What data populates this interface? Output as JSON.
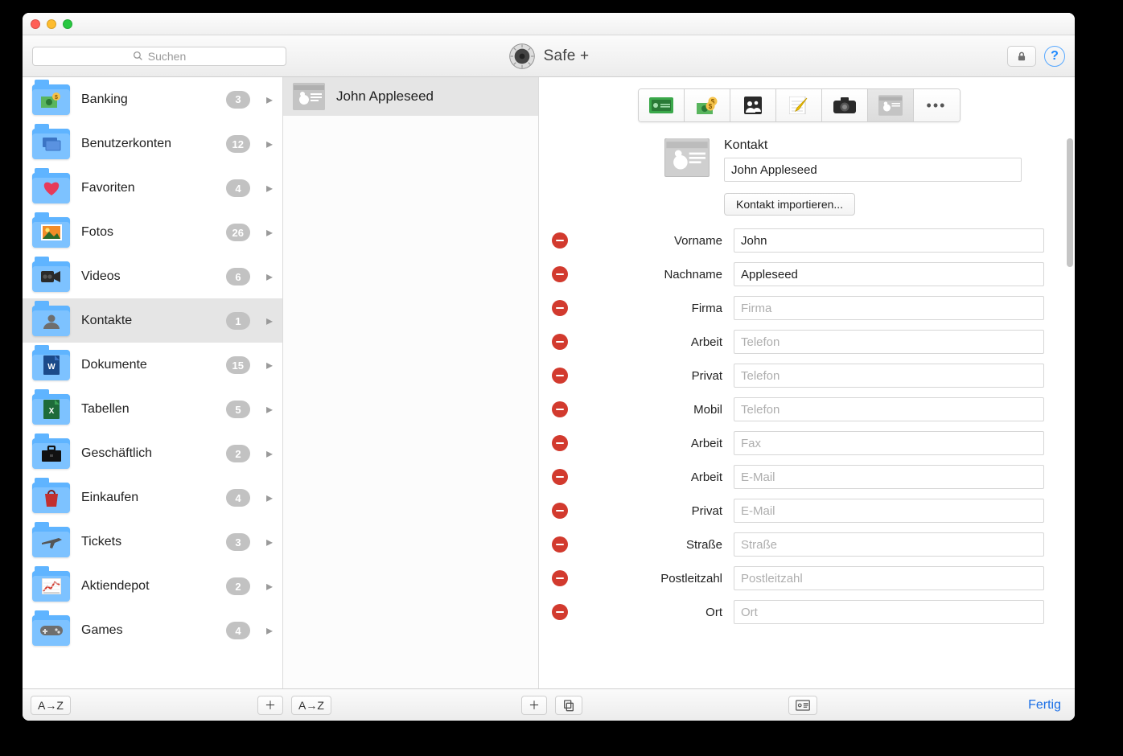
{
  "app": {
    "title": "Safe +"
  },
  "toolbar": {
    "search_placeholder": "Suchen"
  },
  "sidebar": {
    "categories": [
      {
        "id": "banking",
        "label": "Banking",
        "count": 3,
        "icon": "banking"
      },
      {
        "id": "benutzerkonten",
        "label": "Benutzerkonten",
        "count": 12,
        "icon": "accounts"
      },
      {
        "id": "favoriten",
        "label": "Favoriten",
        "count": 4,
        "icon": "heart"
      },
      {
        "id": "fotos",
        "label": "Fotos",
        "count": 26,
        "icon": "photos"
      },
      {
        "id": "videos",
        "label": "Videos",
        "count": 6,
        "icon": "video"
      },
      {
        "id": "kontakte",
        "label": "Kontakte",
        "count": 1,
        "icon": "contact",
        "selected": true
      },
      {
        "id": "dokumente",
        "label": "Dokumente",
        "count": 15,
        "icon": "word"
      },
      {
        "id": "tabellen",
        "label": "Tabellen",
        "count": 5,
        "icon": "excel"
      },
      {
        "id": "geschaeftlich",
        "label": "Geschäftlich",
        "count": 2,
        "icon": "briefcase"
      },
      {
        "id": "einkaufen",
        "label": "Einkaufen",
        "count": 4,
        "icon": "bag"
      },
      {
        "id": "tickets",
        "label": "Tickets",
        "count": 3,
        "icon": "plane"
      },
      {
        "id": "aktiendepot",
        "label": "Aktiendepot",
        "count": 2,
        "icon": "stocks"
      },
      {
        "id": "games",
        "label": "Games",
        "count": 4,
        "icon": "gamepad"
      }
    ]
  },
  "entries": [
    {
      "name": "John Appleseed"
    }
  ],
  "detail": {
    "type_label": "Kontakt",
    "name": "John Appleseed",
    "import_button": "Kontakt importieren...",
    "fields": [
      {
        "label": "Vorname",
        "value": "John",
        "placeholder": ""
      },
      {
        "label": "Nachname",
        "value": "Appleseed",
        "placeholder": ""
      },
      {
        "label": "Firma",
        "value": "",
        "placeholder": "Firma"
      },
      {
        "label": "Arbeit",
        "value": "",
        "placeholder": "Telefon"
      },
      {
        "label": "Privat",
        "value": "",
        "placeholder": "Telefon"
      },
      {
        "label": "Mobil",
        "value": "",
        "placeholder": "Telefon"
      },
      {
        "label": "Arbeit",
        "value": "",
        "placeholder": "Fax"
      },
      {
        "label": "Arbeit",
        "value": "",
        "placeholder": "E-Mail"
      },
      {
        "label": "Privat",
        "value": "",
        "placeholder": "E-Mail"
      },
      {
        "label": "Straße",
        "value": "",
        "placeholder": "Straße"
      },
      {
        "label": "Postleitzahl",
        "value": "",
        "placeholder": "Postleitzahl"
      },
      {
        "label": "Ort",
        "value": "",
        "placeholder": "Ort"
      }
    ]
  },
  "footer": {
    "sort_label": "A→Z",
    "done_label": "Fertig"
  }
}
